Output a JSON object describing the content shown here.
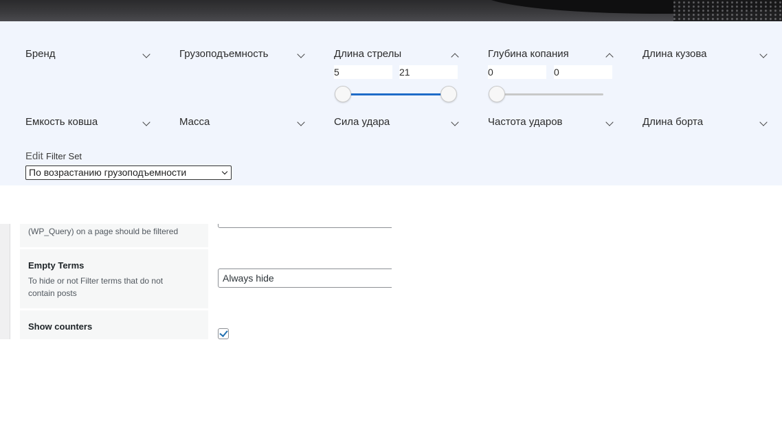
{
  "filters": {
    "row1": [
      {
        "label": "Бренд",
        "state": "collapsed"
      },
      {
        "label": "Грузоподъемность",
        "state": "collapsed"
      },
      {
        "label": "Длина стрелы",
        "state": "expanded",
        "min_value": "5",
        "max_value": "21",
        "range_from_fraction": 0.0,
        "range_to_fraction": 1.0
      },
      {
        "label": "Глубина копания",
        "state": "expanded",
        "min_value": "0",
        "max_value": "0",
        "range_from_fraction": 0.0,
        "range_to_fraction": 0.0
      },
      {
        "label": "Длина кузова",
        "state": "collapsed"
      }
    ],
    "row2": [
      {
        "label": "Емкость ковша"
      },
      {
        "label": "Масса"
      },
      {
        "label": "Сила удара"
      },
      {
        "label": "Частота ударов"
      },
      {
        "label": "Длина борта"
      }
    ]
  },
  "edit": {
    "edit_word": "Edit",
    "filter_set": "Filter Set"
  },
  "sort": {
    "selected": "По возрастанию грузоподъемности"
  },
  "admin": {
    "row_query_desc": "(WP_Query) on a page should be filtered",
    "empty_terms": {
      "title": "Empty Terms",
      "desc": "To hide or not Filter terms that do not contain posts",
      "value": "Always hide"
    },
    "show_counters": {
      "title": "Show counters",
      "checked": true
    }
  },
  "colors": {
    "filter_bg": "#f1f5fd",
    "slider_fill": "#1e6bc8",
    "admin_checkbox": "#2271b1"
  }
}
